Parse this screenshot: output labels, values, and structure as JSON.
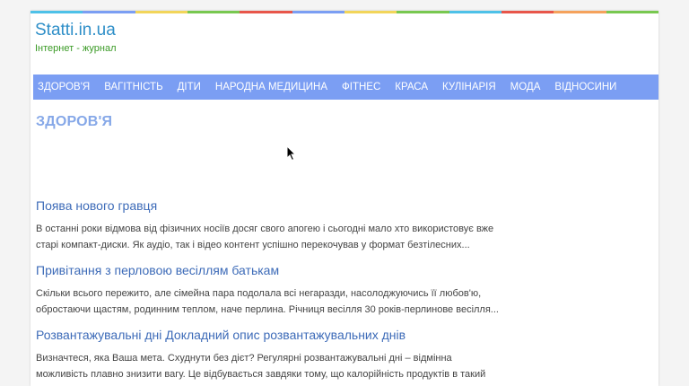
{
  "stripe_colors": [
    "#4ec1e8",
    "#7b9ef3",
    "#f2d55a",
    "#78c850",
    "#e8564a",
    "#7b9ef3",
    "#f2d55a",
    "#78c850",
    "#4ec1e8",
    "#e8564a",
    "#f5a25c",
    "#78c850"
  ],
  "header": {
    "site_title": "Statti.in.ua",
    "site_subtitle": "Інтернет - журнал"
  },
  "nav": {
    "items": [
      {
        "label": "ЗДОРОВ'Я"
      },
      {
        "label": "ВАГІТНІСТЬ"
      },
      {
        "label": "ДІТИ"
      },
      {
        "label": "НАРОДНА МЕДИЦИНА"
      },
      {
        "label": "ФІТНЕС"
      },
      {
        "label": "КРАСА"
      },
      {
        "label": "КУЛІНАРІЯ"
      },
      {
        "label": "МОДА"
      },
      {
        "label": "ВІДНОСИНИ"
      }
    ]
  },
  "main": {
    "section_title": "ЗДОРОВ'Я",
    "articles": [
      {
        "title": "Поява нового гравця",
        "excerpt": "В останні роки відмова від фізичних носіїв досяг свого апогею і сьогодні мало хто використовує вже старі компакт-диски. Як аудіо, так і відео контент успішно перекочував у формат безтілесних..."
      },
      {
        "title": "Привітання з перловою весіллям батькам",
        "excerpt": "Скільки всього пережито, але сімейна пара подолала всі негаразди, насолоджуючись її любов'ю, обростаючи щастям, родинним теплом, наче перлина. Річниця весілля 30 років-перлинове весілля..."
      },
      {
        "title": "Розвантажувальні дні Докладний опис розвантажувальних днів",
        "excerpt": "Визначтеся, яка Ваша мета. Схуднути без дієт? Регулярні розвантажувальні дні – відмінна можливість плавно знизити вагу. Це відбувається завдяки тому, що калорійність продуктів в такий день..."
      }
    ]
  }
}
